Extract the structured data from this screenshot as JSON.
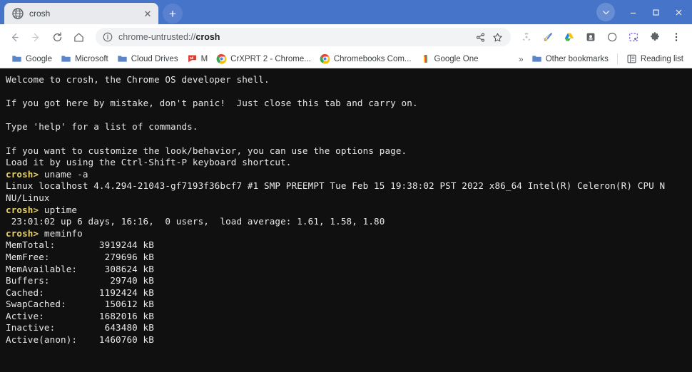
{
  "window": {
    "controls": {
      "chevron_label": "⌄",
      "minimize_label": "–",
      "maximize_label": "☐",
      "close_label": "✕"
    }
  },
  "tabstrip": {
    "tabs": [
      {
        "title": "crosh",
        "favicon": "globe-icon",
        "close_label": "✕"
      }
    ],
    "new_tab_label": "+"
  },
  "toolbar": {
    "back_label": "←",
    "forward_label": "→",
    "reload_label": "↻",
    "home_label": "⌂",
    "omnibox": {
      "info_icon": "page-info-icon",
      "url_prefix": "chrome-untrusted://",
      "url_page": "crosh",
      "full_url": "chrome-untrusted://crosh"
    },
    "share_label": "share-icon",
    "bookmark_star_label": "☆",
    "extensions": [
      "radiation-extension-icon",
      "keep-extension-icon",
      "google-drive-icon",
      "screencast-extension-icon",
      "circle-extension-icon",
      "screen-capture-icon"
    ],
    "puzzle_label": "extensions-puzzle-icon",
    "menu_label": "⋮"
  },
  "bookmarks": {
    "items": [
      {
        "label": "Google",
        "icon": "folder-icon"
      },
      {
        "label": "Microsoft",
        "icon": "folder-icon"
      },
      {
        "label": "Cloud Drives",
        "icon": "folder-icon"
      },
      {
        "label": "M",
        "icon": "red-flag-icon"
      },
      {
        "label": "CrXPRT 2 - Chrome...",
        "icon": "chrome-icon"
      },
      {
        "label": "Chromebooks Com...",
        "icon": "chrome-icon"
      },
      {
        "label": "Google One",
        "icon": "google-one-icon"
      }
    ],
    "overflow_label": "»",
    "other_bookmarks_label": "Other bookmarks",
    "reading_list_label": "Reading list"
  },
  "terminal": {
    "background_color": "#101010",
    "text_color": "#e8e8e8",
    "prompt_color": "#e9d16c",
    "prompt": "crosh>",
    "lines": [
      {
        "type": "text",
        "text": "Welcome to crosh, the Chrome OS developer shell."
      },
      {
        "type": "text",
        "text": ""
      },
      {
        "type": "text",
        "text": "If you got here by mistake, don't panic!  Just close this tab and carry on."
      },
      {
        "type": "text",
        "text": ""
      },
      {
        "type": "text",
        "text": "Type 'help' for a list of commands."
      },
      {
        "type": "text",
        "text": ""
      },
      {
        "type": "text",
        "text": "If you want to customize the look/behavior, you can use the options page."
      },
      {
        "type": "text",
        "text": "Load it by using the Ctrl-Shift-P keyboard shortcut."
      },
      {
        "type": "command",
        "command": "uname -a"
      },
      {
        "type": "text",
        "text": "Linux localhost 4.4.294-21043-gf7193f36bcf7 #1 SMP PREEMPT Tue Feb 15 19:38:02 PST 2022 x86_64 Intel(R) Celeron(R) CPU N"
      },
      {
        "type": "text",
        "text": "NU/Linux"
      },
      {
        "type": "command",
        "command": "uptime"
      },
      {
        "type": "text",
        "text": " 23:01:02 up 6 days, 16:16,  0 users,  load average: 1.61, 1.58, 1.80"
      },
      {
        "type": "command",
        "command": "meminfo"
      },
      {
        "type": "text",
        "text": "MemTotal:        3919244 kB"
      },
      {
        "type": "text",
        "text": "MemFree:          279696 kB"
      },
      {
        "type": "text",
        "text": "MemAvailable:     308624 kB"
      },
      {
        "type": "text",
        "text": "Buffers:           29740 kB"
      },
      {
        "type": "text",
        "text": "Cached:          1192424 kB"
      },
      {
        "type": "text",
        "text": "SwapCached:       150612 kB"
      },
      {
        "type": "text",
        "text": "Active:          1682016 kB"
      },
      {
        "type": "text",
        "text": "Inactive:         643480 kB"
      },
      {
        "type": "text",
        "text": "Active(anon):    1460760 kB"
      }
    ]
  }
}
